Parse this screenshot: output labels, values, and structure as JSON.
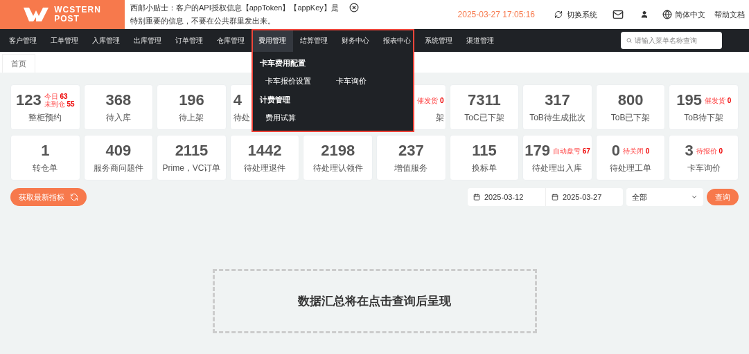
{
  "header": {
    "logo": {
      "line1": "WCSTERN",
      "line2": "POST"
    },
    "notice": "西邮小贴士：客户的API授权信息【appToken】【appKey】是特别重要的信息，不要在公共群里发出来。",
    "datetime": "2025-03-27 17:05:16",
    "switch_system": "切换系统",
    "language": "简体中文",
    "help": "帮助文档"
  },
  "nav": {
    "items": [
      {
        "label": "客户管理",
        "selected": false
      },
      {
        "label": "工单管理",
        "selected": false
      },
      {
        "label": "入库管理",
        "selected": false
      },
      {
        "label": "出库管理",
        "selected": false
      },
      {
        "label": "订单管理",
        "selected": false
      },
      {
        "label": "仓库管理",
        "selected": false
      },
      {
        "label": "费用管理",
        "selected": true
      },
      {
        "label": "结算管理",
        "selected": false
      },
      {
        "label": "财务中心",
        "selected": false
      },
      {
        "label": "报表中心",
        "selected": false
      },
      {
        "label": "系统管理",
        "selected": false
      },
      {
        "label": "渠道管理",
        "selected": false
      }
    ],
    "search_placeholder": "请输入菜单名称查询"
  },
  "dropdown": {
    "groups": [
      {
        "title": "卡车费用配置",
        "items": [
          "卡车报价设置",
          "卡车询价"
        ]
      },
      {
        "title": "计费管理",
        "items": [
          "费用试算"
        ]
      }
    ]
  },
  "tabs": [
    {
      "label": "首页",
      "selected": true
    }
  ],
  "cards_row_1": [
    {
      "kind": "full",
      "value": "123",
      "label": "整柜预约",
      "badges": [
        {
          "label": "今日",
          "count": "63"
        },
        {
          "label": "未到仓",
          "count": "55"
        }
      ]
    },
    {
      "kind": "full",
      "value": "368",
      "label": "待入库"
    },
    {
      "kind": "full",
      "value": "196",
      "label": "待上架"
    },
    {
      "kind": "left",
      "value": "4",
      "label": "待处"
    },
    {
      "kind": "hidden"
    },
    {
      "kind": "right",
      "label": "架",
      "badges": [
        {
          "label": "催发货",
          "count": "0"
        }
      ]
    },
    {
      "kind": "full",
      "value": "7311",
      "label": "ToC已下架"
    },
    {
      "kind": "full",
      "value": "317",
      "label": "ToB待生成批次"
    },
    {
      "kind": "full",
      "value": "800",
      "label": "ToB已下架"
    },
    {
      "kind": "full",
      "value": "195",
      "label": "ToB待下架",
      "badges": [
        {
          "label": "催发货",
          "count": "0"
        }
      ]
    }
  ],
  "cards_row_2": [
    {
      "kind": "full",
      "value": "1",
      "label": "转仓单"
    },
    {
      "kind": "full",
      "value": "409",
      "label": "服务商问题件"
    },
    {
      "kind": "full",
      "value": "2115",
      "label": "Prime，VC订单"
    },
    {
      "kind": "full",
      "value": "1442",
      "label": "待处理退件"
    },
    {
      "kind": "full",
      "value": "2198",
      "label": "待处理认领件"
    },
    {
      "kind": "full",
      "value": "237",
      "label": "增值服务"
    },
    {
      "kind": "full",
      "value": "115",
      "label": "换标单"
    },
    {
      "kind": "full",
      "value": "179",
      "label": "待处理出入库",
      "badges": [
        {
          "label": "自动盘亏",
          "count": "67"
        }
      ]
    },
    {
      "kind": "full",
      "value": "0",
      "label": "待处理工单",
      "badges": [
        {
          "label": "待关闭",
          "count": "0"
        }
      ]
    },
    {
      "kind": "full",
      "value": "3",
      "label": "卡车询价",
      "badges": [
        {
          "label": "待报价",
          "count": "0"
        }
      ]
    }
  ],
  "toolbar": {
    "refresh_button": "获取最新指标",
    "start_date": "2025-03-12",
    "end_date": "2025-03-27",
    "filter": "全部",
    "query_button": "查询"
  },
  "empty_state": "数据汇总将在点击查询后呈现"
}
